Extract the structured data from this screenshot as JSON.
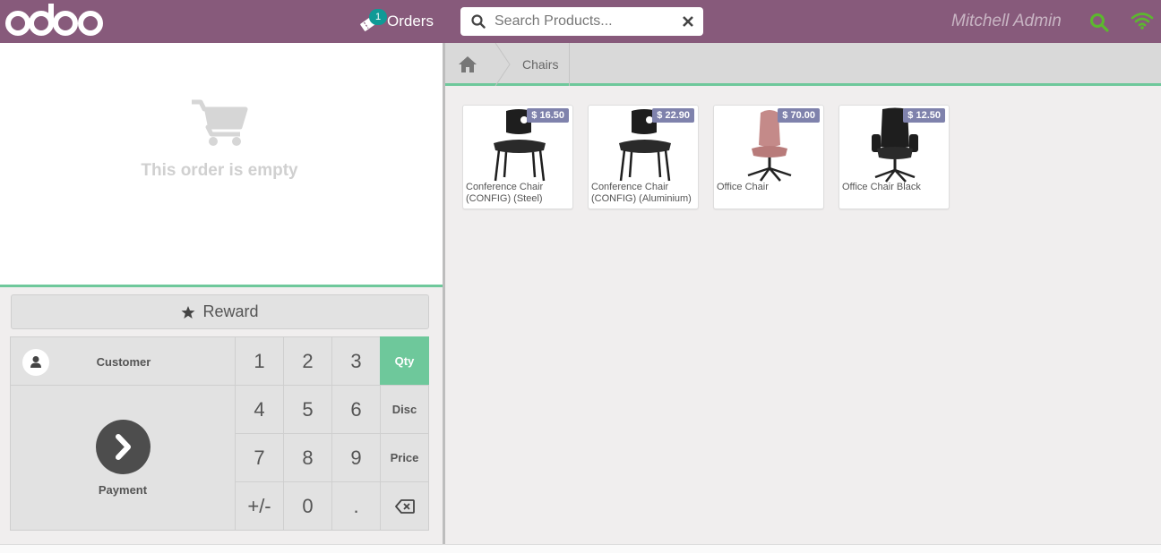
{
  "header": {
    "logo_text": "odoo",
    "orders_label": "Orders",
    "orders_count": "1",
    "search_placeholder": "Search Products...",
    "user_name": "Mitchell Admin",
    "bg_color": "#875a7b"
  },
  "order": {
    "empty_text": "This order is empty"
  },
  "actions": {
    "reward_label": "Reward",
    "customer_label": "Customer",
    "payment_label": "Payment"
  },
  "numpad": {
    "keys": [
      "1",
      "2",
      "3",
      "4",
      "5",
      "6",
      "7",
      "8",
      "9",
      "+/-",
      "0",
      "."
    ],
    "modes": [
      "Qty",
      "Disc",
      "Price"
    ],
    "active_mode": "Qty"
  },
  "breadcrumb": {
    "category": "Chairs"
  },
  "products": [
    {
      "price": "$ 16.50",
      "name": "Conference Chair (CONFIG) (Steel)",
      "icon": "black-chair"
    },
    {
      "price": "$ 22.90",
      "name": "Conference Chair (CONFIG) (Aluminium)",
      "icon": "black-chair"
    },
    {
      "price": "$ 70.00",
      "name": "Office Chair",
      "icon": "pink-swivel-chair"
    },
    {
      "price": "$ 12.50",
      "name": "Office Chair Black",
      "icon": "black-office-chair"
    }
  ],
  "colors": {
    "accent": "#6ec89b",
    "price_badge": "#7f82ac",
    "status_green": "#5cb82e"
  }
}
